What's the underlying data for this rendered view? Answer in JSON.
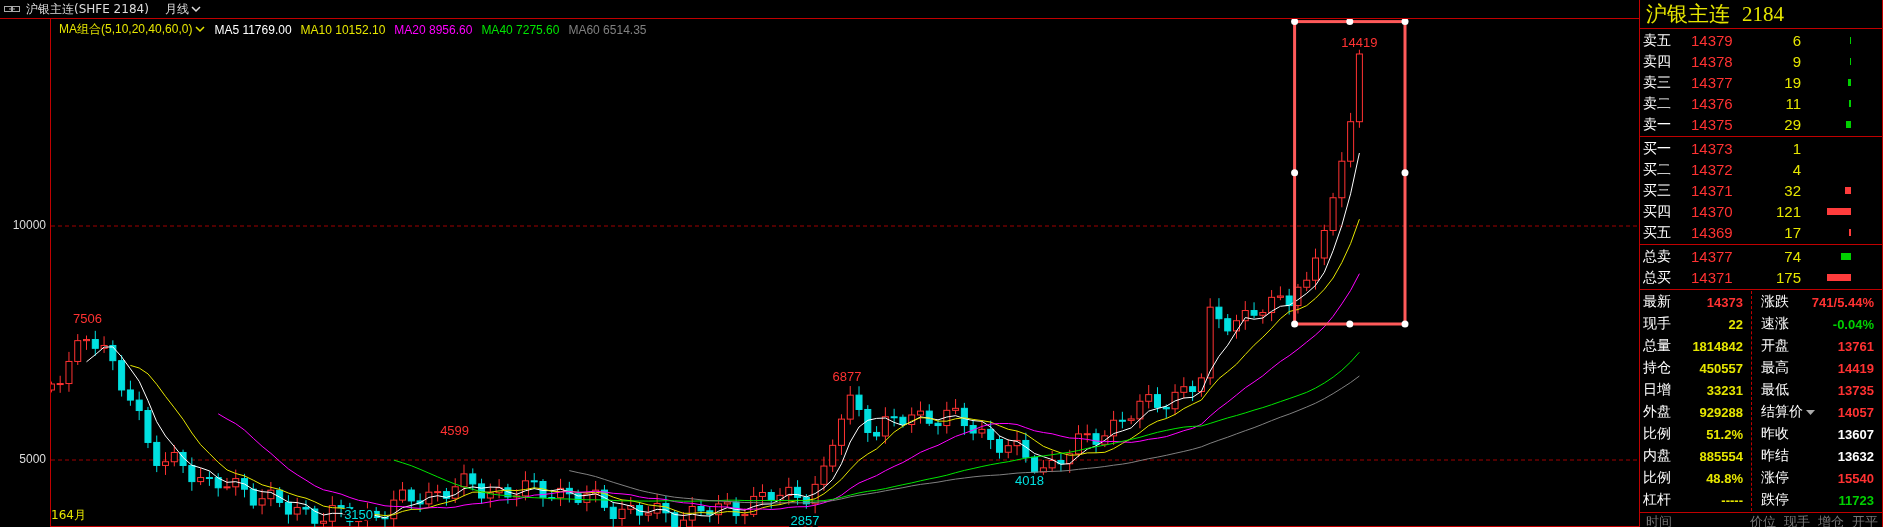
{
  "header": {
    "title": "沪银主连(SHFE 2184)",
    "period": "月线"
  },
  "indicator": {
    "label": "MA组合(5,10,20,40,60,0)"
  },
  "ma_lines": [
    {
      "name": "MA5",
      "value": "11769.00",
      "color": "#ffffff"
    },
    {
      "name": "MA10",
      "value": "10152.10",
      "color": "#e6e600"
    },
    {
      "name": "MA20",
      "value": "8956.60",
      "color": "#ff00ff"
    },
    {
      "name": "MA40",
      "value": "7275.60",
      "color": "#00e600"
    },
    {
      "name": "MA60",
      "value": "6514.35",
      "color": "#808080"
    }
  ],
  "price_chart": {
    "y_labels": [
      "10000",
      "5000"
    ],
    "bottom_label": "164月",
    "annotations": [
      {
        "text": "7506",
        "kind": "high"
      },
      {
        "text": "4599",
        "kind": "high"
      },
      {
        "text": "6877",
        "kind": "high"
      },
      {
        "text": "14419",
        "kind": "high"
      },
      {
        "text": "3150",
        "kind": "low"
      },
      {
        "text": "2857",
        "kind": "low"
      },
      {
        "text": "4018",
        "kind": "low"
      }
    ]
  },
  "quote": {
    "name": "沪银主连",
    "code": "2184"
  },
  "asks": [
    {
      "label": "卖五",
      "price": "14379",
      "volume": "6"
    },
    {
      "label": "卖四",
      "price": "14378",
      "volume": "9"
    },
    {
      "label": "卖三",
      "price": "14377",
      "volume": "19"
    },
    {
      "label": "卖二",
      "price": "14376",
      "volume": "11"
    },
    {
      "label": "卖一",
      "price": "14375",
      "volume": "29"
    }
  ],
  "bids": [
    {
      "label": "买一",
      "price": "14373",
      "volume": "1"
    },
    {
      "label": "买二",
      "price": "14372",
      "volume": "4"
    },
    {
      "label": "买三",
      "price": "14371",
      "volume": "32"
    },
    {
      "label": "买四",
      "price": "14370",
      "volume": "121"
    },
    {
      "label": "买五",
      "price": "14369",
      "volume": "17"
    }
  ],
  "totals": [
    {
      "label": "总卖",
      "price": "14377",
      "volume": "74"
    },
    {
      "label": "总买",
      "price": "14371",
      "volume": "175"
    }
  ],
  "stats_left": [
    {
      "label": "最新",
      "value": "14373",
      "color": "#ff3232"
    },
    {
      "label": "现手",
      "value": "22",
      "color": "#e6e600"
    },
    {
      "label": "总量",
      "value": "1814842",
      "color": "#e6e600"
    },
    {
      "label": "持仓",
      "value": "450557",
      "color": "#e6e600"
    },
    {
      "label": "日增",
      "value": "33231",
      "color": "#e6e600"
    },
    {
      "label": "外盘",
      "value": "929288",
      "color": "#e6e600"
    },
    {
      "label": "比例",
      "value": "51.2%",
      "color": "#e6e600"
    },
    {
      "label": "内盘",
      "value": "885554",
      "color": "#e6e600"
    },
    {
      "label": "比例",
      "value": "48.8%",
      "color": "#e6e600"
    },
    {
      "label": "杠杆",
      "value": "-----",
      "color": "#e6e600"
    }
  ],
  "stats_right": [
    {
      "label": "涨跌",
      "value": "741/5.44%",
      "color": "#ff3232",
      "dropdown": false
    },
    {
      "label": "速涨",
      "value": "-0.04%",
      "color": "#00d000",
      "dropdown": false
    },
    {
      "label": "开盘",
      "value": "13761",
      "color": "#ff3232",
      "dropdown": false
    },
    {
      "label": "最高",
      "value": "14419",
      "color": "#ff3232",
      "dropdown": false
    },
    {
      "label": "最低",
      "value": "13735",
      "color": "#ff3232",
      "dropdown": false
    },
    {
      "label": "结算价",
      "value": "14057",
      "color": "#ff3232",
      "dropdown": true
    },
    {
      "label": "昨收",
      "value": "13607",
      "color": "#ffffff",
      "dropdown": false
    },
    {
      "label": "昨结",
      "value": "13632",
      "color": "#ffffff",
      "dropdown": false
    },
    {
      "label": "涨停",
      "value": "15540",
      "color": "#ff3232",
      "dropdown": false
    },
    {
      "label": "跌停",
      "value": "11723",
      "color": "#00d000",
      "dropdown": false
    }
  ],
  "trade_columns": [
    "时间",
    "价位",
    "现手",
    "增仓",
    "开平"
  ]
}
